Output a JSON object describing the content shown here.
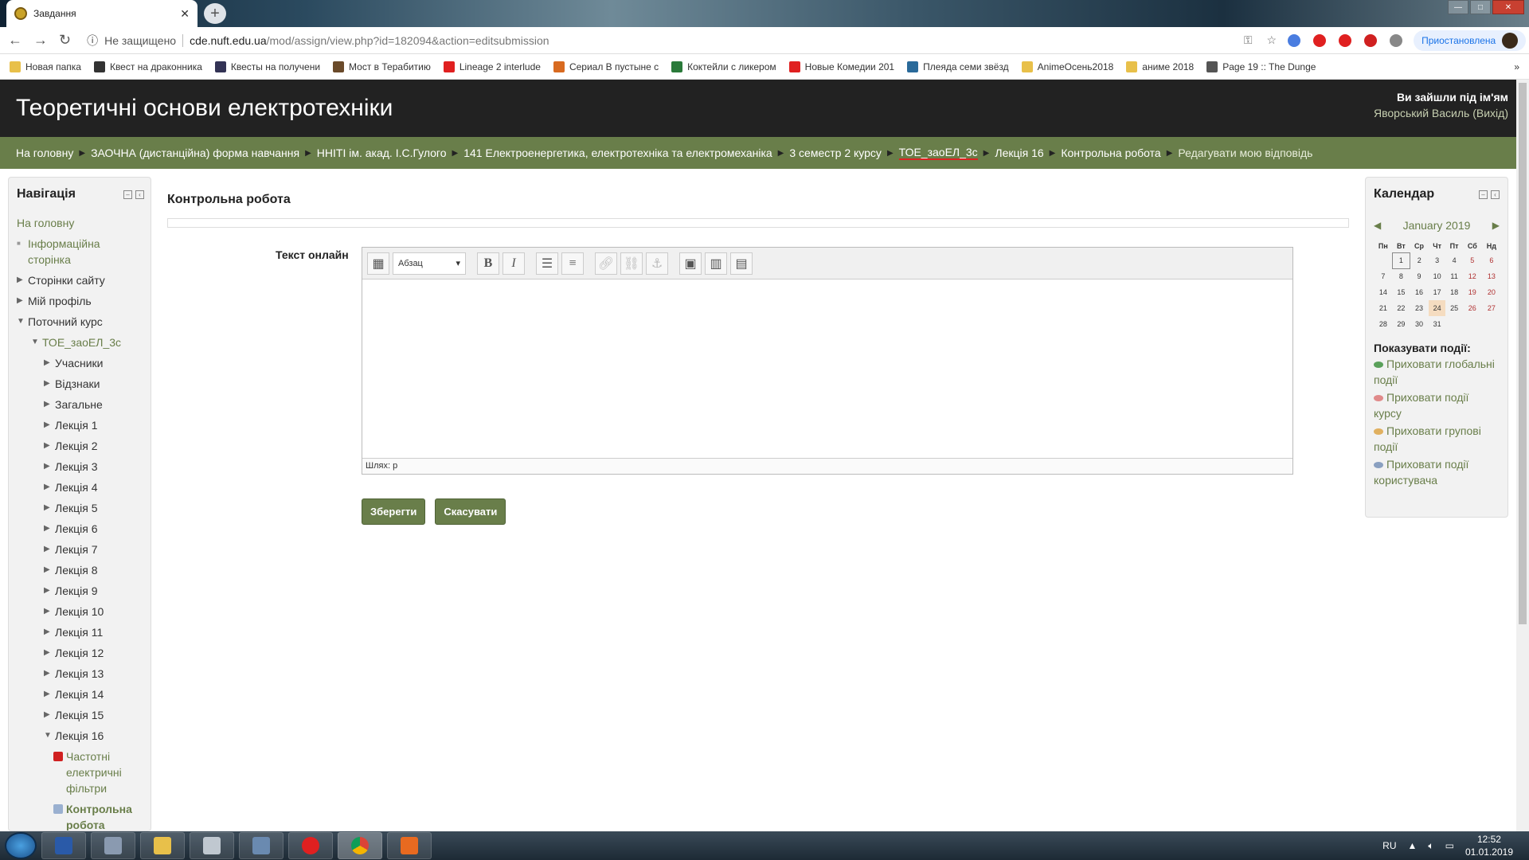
{
  "browser": {
    "tab_title": "Завдання",
    "security": "Не защищено",
    "url_host": "cde.nuft.edu.ua",
    "url_path": "/mod/assign/view.php?id=182094&action=editsubmission",
    "profile_status": "Приостановлена"
  },
  "bookmarks": [
    {
      "label": "Новая папка",
      "color": "#e8c04a"
    },
    {
      "label": "Квест на драконника",
      "color": "#333"
    },
    {
      "label": "Квесты на получени",
      "color": "#335"
    },
    {
      "label": "Мост в Терабитию",
      "color": "#6a4a2a"
    },
    {
      "label": "Lineage 2 interlude",
      "color": "#e02020"
    },
    {
      "label": "Сериал В пустыне с",
      "color": "#d86a20"
    },
    {
      "label": "Коктейли с ликером",
      "color": "#2a7a3a"
    },
    {
      "label": "Новые Комедии 201",
      "color": "#e02020"
    },
    {
      "label": "Плеяда семи звёзд",
      "color": "#2a6a9a"
    },
    {
      "label": "AnimeОсень2018",
      "color": "#e8c04a"
    },
    {
      "label": "аниме 2018",
      "color": "#e8c04a"
    },
    {
      "label": "Page 19 :: The Dunge",
      "color": "#555"
    }
  ],
  "site": {
    "title": "Теоретичні основи електротехніки",
    "login_line": "Ви зайшли під ім'ям",
    "user": "Яворський Василь",
    "logout": "Вихід"
  },
  "breadcrumb": [
    "На головну",
    "ЗАОЧНА (дистанційна) форма навчання",
    "ННІТІ ім. акад. І.С.Гулого",
    "141 Електроенергетика, електротехніка та електромеханіка",
    "3 семестр 2 курсу",
    "ТОЕ_заоЕЛ_3с",
    "Лекція 16",
    "Контрольна робота",
    "Редагувати мою відповідь"
  ],
  "nav": {
    "title": "Навігація",
    "home": "На головну",
    "info_page": "Інформаційна сторінка",
    "site_pages": "Сторінки сайту",
    "my_profile": "Мій профіль",
    "current_course": "Поточний курс",
    "course": "ТОЕ_заоЕЛ_3с",
    "items": [
      "Учасники",
      "Відзнаки",
      "Загальне",
      "Лекція 1",
      "Лекція 2",
      "Лекція 3",
      "Лекція 4",
      "Лекція 5",
      "Лекція 6",
      "Лекція 7",
      "Лекція 8",
      "Лекція 9",
      "Лекція 10",
      "Лекція 11",
      "Лекція 12",
      "Лекція 13",
      "Лекція 14",
      "Лекція 15",
      "Лекція 16"
    ],
    "sub_pdf": "Частотні електричні фільтри",
    "sub_assign": "Контрольна робота"
  },
  "main": {
    "heading": "Контрольна робота",
    "field_label": "Текст онлайн",
    "format_select": "Абзац",
    "path_label": "Шлях: p",
    "save": "Зберегти",
    "cancel": "Скасувати"
  },
  "calendar": {
    "title": "Календар",
    "month": "January 2019",
    "weekdays": [
      "Пн",
      "Вт",
      "Ср",
      "Чт",
      "Пт",
      "Сб",
      "Нд"
    ],
    "weeks": [
      [
        "",
        "1",
        "2",
        "3",
        "4",
        "5",
        "6"
      ],
      [
        "7",
        "8",
        "9",
        "10",
        "11",
        "12",
        "13"
      ],
      [
        "14",
        "15",
        "16",
        "17",
        "18",
        "19",
        "20"
      ],
      [
        "21",
        "22",
        "23",
        "24",
        "25",
        "26",
        "27"
      ],
      [
        "28",
        "29",
        "30",
        "31",
        "",
        "",
        ""
      ]
    ],
    "events_title": "Показувати події:",
    "events": [
      {
        "label": "Приховати глобальні події",
        "color": "#5aa05a"
      },
      {
        "label": "Приховати події курсу",
        "color": "#e08a8a"
      },
      {
        "label": "Приховати групові події",
        "color": "#e0b060"
      },
      {
        "label": "Приховати події користувача",
        "color": "#8aa0c0"
      }
    ]
  },
  "taskbar": {
    "lang": "RU",
    "time": "12:52",
    "date": "01.01.2019"
  }
}
